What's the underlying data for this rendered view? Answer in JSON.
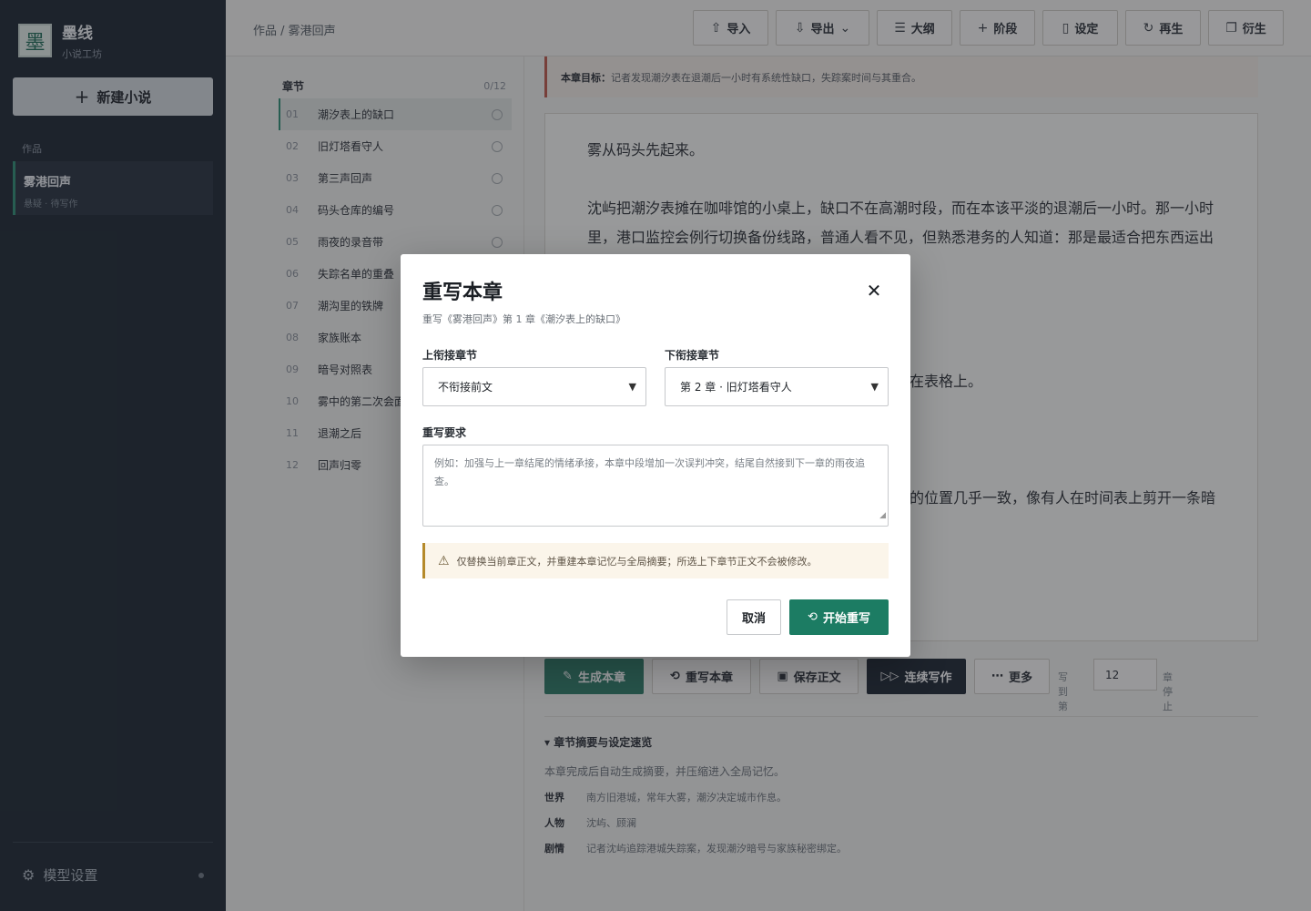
{
  "sidebar": {
    "logo": "墨",
    "brand_name": "墨线",
    "brand_sub": "小说工坊",
    "new_novel": "新建小说",
    "works_label": "作品",
    "work": {
      "title": "雾港回声",
      "meta": "悬疑 · 待写作"
    },
    "model_settings": "模型设置"
  },
  "topbar": {
    "breadcrumb": "作品 / 雾港回声",
    "buttons": {
      "import": "导入",
      "export": "导出",
      "outline": "大纲",
      "stage": "阶段",
      "settings": "设定",
      "regen": "再生",
      "derive": "衍生"
    }
  },
  "chapters": {
    "header": "章节",
    "count": "0/12",
    "items": [
      {
        "num": "01",
        "title": "潮汐表上的缺口"
      },
      {
        "num": "02",
        "title": "旧灯塔看守人"
      },
      {
        "num": "03",
        "title": "第三声回声"
      },
      {
        "num": "04",
        "title": "码头仓库的编号"
      },
      {
        "num": "05",
        "title": "雨夜的录音带"
      },
      {
        "num": "06",
        "title": "失踪名单的重叠"
      },
      {
        "num": "07",
        "title": "潮沟里的铁牌"
      },
      {
        "num": "08",
        "title": "家族账本"
      },
      {
        "num": "09",
        "title": "暗号对照表"
      },
      {
        "num": "10",
        "title": "雾中的第二次会面"
      },
      {
        "num": "11",
        "title": "退潮之后"
      },
      {
        "num": "12",
        "title": "回声归零"
      }
    ]
  },
  "editor": {
    "goal_label": "本章目标：",
    "goal_text": "记者发现潮汐表在退潮后一小时有系统性缺口，失踪案时间与其重合。",
    "p1": "雾从码头先起来。",
    "p2": "沈屿把潮汐表摊在咖啡馆的小桌上，缺口不在高潮时段，而在本该平淡的退潮后一小时。那一小时里，港口监控会例行切换备份线路，普通人看不见，但熟悉港务的人知道：那是最适合把东西运出",
    "frag1": "在表格上。",
    "frag2": "的位置几乎一致，像有人在时间表上剪开一条暗"
  },
  "actions": {
    "generate": "生成本章",
    "rewrite": "重写本章",
    "save": "保存正文",
    "continuous": "连续写作",
    "more": "更多",
    "write_to": "写到第",
    "chapter_num": "12",
    "stop_suffix": "章停止"
  },
  "summary": {
    "title": "▾ 章节摘要与设定速览",
    "desc": "本章完成后自动生成摘要，并压缩进入全局记忆。",
    "rows": [
      {
        "key": "世界",
        "value": "南方旧港城，常年大雾，潮汐决定城市作息。"
      },
      {
        "key": "人物",
        "value": "沈屿、顾澜"
      },
      {
        "key": "剧情",
        "value": "记者沈屿追踪港城失踪案，发现潮汐暗号与家族秘密绑定。"
      }
    ]
  },
  "modal": {
    "title": "重写本章",
    "subtitle": "重写《雾港回声》第 1 章《潮汐表上的缺口》",
    "prev_label": "上衔接章节",
    "prev_value": "不衔接前文",
    "next_label": "下衔接章节",
    "next_value": "第 2 章 · 旧灯塔看守人",
    "req_label": "重写要求",
    "req_placeholder": "例如：加强与上一章结尾的情绪承接，本章中段增加一次误判冲突，结尾自然接到下一章的雨夜追查。",
    "warning": "仅替换当前章正文，并重建本章记忆与全局摘要；所选上下章节正文不会被修改。",
    "cancel": "取消",
    "start": "开始重写"
  },
  "colors": {
    "accent": "#1c7c63",
    "sidebar_bg": "#1d2530",
    "goal_border": "#c0584a",
    "warning_border": "#b58a2a"
  }
}
